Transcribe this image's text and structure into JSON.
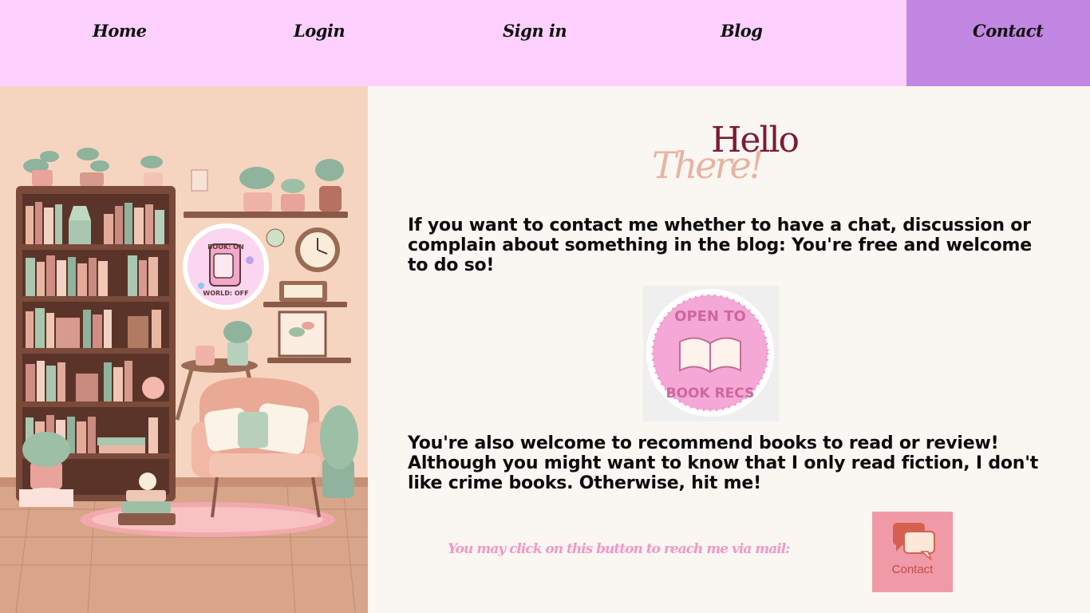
{
  "nav": {
    "items": [
      {
        "label": "Home"
      },
      {
        "label": "Login"
      },
      {
        "label": "Sign in"
      },
      {
        "label": "Blog"
      },
      {
        "label": "Contact"
      }
    ],
    "active": "Contact"
  },
  "illustration": {
    "sticker_top": "BOOK: ON",
    "sticker_bottom": "WORLD: OFF"
  },
  "main": {
    "hello_line1": "Hello",
    "hello_line2": "There!",
    "intro": "If you want to contact me whether to have a chat, discussion or complain about something in the blog: You're free and welcome to do so!",
    "badge_top": "OPEN TO",
    "badge_bottom": "BOOK RECS",
    "recommend": "You're also welcome to recommend books to read or review! Although you might want to know that I only read fiction, I don't like crime books. Otherwise, hit me!",
    "mail_note": "You may click on this button to reach me via mail:",
    "contact_button": "Contact"
  },
  "colors": {
    "nav_bg": "#fdd0fd",
    "nav_active": "#c287e3",
    "left_bg": "#f6d5c0",
    "accent_pink": "#f497c6",
    "hello": "#7b1a38"
  }
}
